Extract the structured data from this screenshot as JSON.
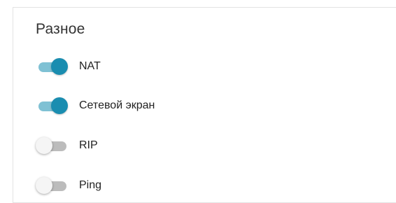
{
  "section": {
    "title": "Разное"
  },
  "toggles": [
    {
      "label": "NAT",
      "enabled": true
    },
    {
      "label": "Сетевой экран",
      "enabled": true
    },
    {
      "label": "RIP",
      "enabled": false
    },
    {
      "label": "Ping",
      "enabled": false
    }
  ],
  "colors": {
    "toggle_on_knob": "#1a8db0",
    "toggle_on_track": "#7fc1d4",
    "toggle_off_knob": "#f5f5f5",
    "toggle_off_track": "#bcbcbc"
  }
}
